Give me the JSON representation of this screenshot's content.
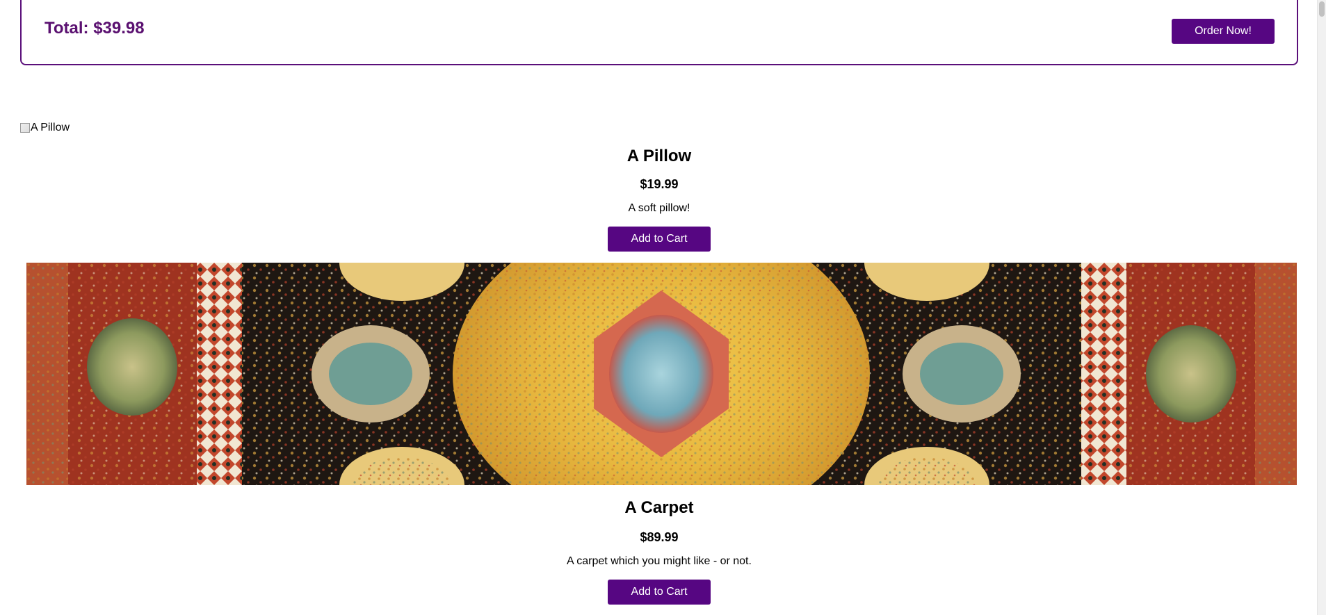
{
  "cart": {
    "total_label": "Total: $39.98",
    "order_button": "Order Now!"
  },
  "products": [
    {
      "image_alt": "A Pillow",
      "name": "A Pillow",
      "price": "$19.99",
      "description": "A soft pillow!",
      "button": "Add to Cart"
    },
    {
      "image_alt": "A Carpet",
      "name": "A Carpet",
      "price": "$89.99",
      "description": "A carpet which you might like - or not.",
      "button": "Add to Cart"
    }
  ],
  "colors": {
    "accent": "#560682",
    "total_text": "#5a1070"
  }
}
